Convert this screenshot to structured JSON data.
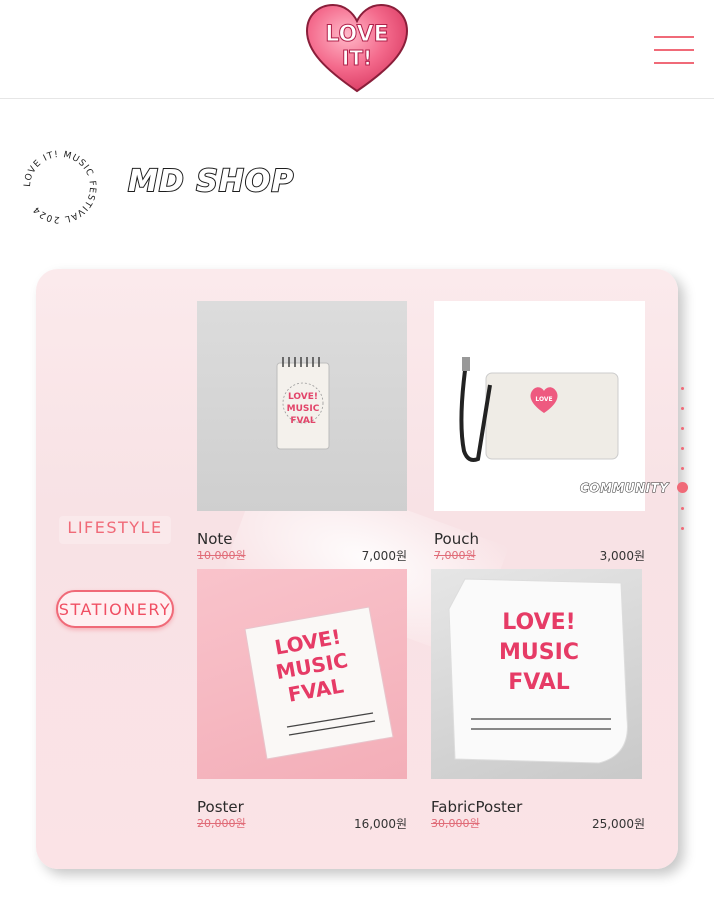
{
  "header": {
    "logo_text_line1": "LOVE",
    "logo_text_line2": "IT!",
    "menu_icon": "hamburger-icon"
  },
  "badge": {
    "text": "LOVE IT! MUSIC FESTIVAL 2024"
  },
  "page_title": "MD SHOP",
  "categories": [
    {
      "label": "LIFESTYLE",
      "active": false
    },
    {
      "label": "STATIONERY",
      "active": true
    }
  ],
  "products": [
    {
      "name": "Note",
      "old_price": "10,000원",
      "price": "7,000원"
    },
    {
      "name": "Pouch",
      "old_price": "7,000원",
      "price": "3,000원"
    },
    {
      "name": "Poster",
      "old_price": "20,000원",
      "price": "16,000원"
    },
    {
      "name": "FabricPoster",
      "old_price": "30,000원",
      "price": "25,000원"
    }
  ],
  "side_nav": {
    "active_label": "COMMUNITY"
  },
  "colors": {
    "accent": "#f06a78",
    "heart": "#f0577a",
    "panel": "#fbe8eb"
  }
}
